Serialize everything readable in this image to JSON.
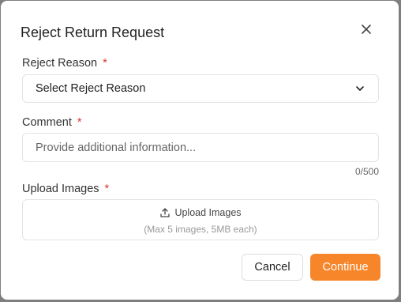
{
  "dialog": {
    "title": "Reject Return Request"
  },
  "reject_reason": {
    "label": "Reject Reason",
    "required_mark": "*",
    "selected": "Select Reject Reason"
  },
  "comment": {
    "label": "Comment",
    "required_mark": "*",
    "value": "",
    "placeholder": "Provide additional information...",
    "counter": "0/500"
  },
  "upload": {
    "label": "Upload Images",
    "required_mark": "*",
    "button_text": "Upload Images",
    "hint": "(Max 5 images, 5MB each)"
  },
  "actions": {
    "cancel": "Cancel",
    "continue": "Continue"
  },
  "colors": {
    "accent": "#f7862a",
    "required": "#dd3333"
  }
}
